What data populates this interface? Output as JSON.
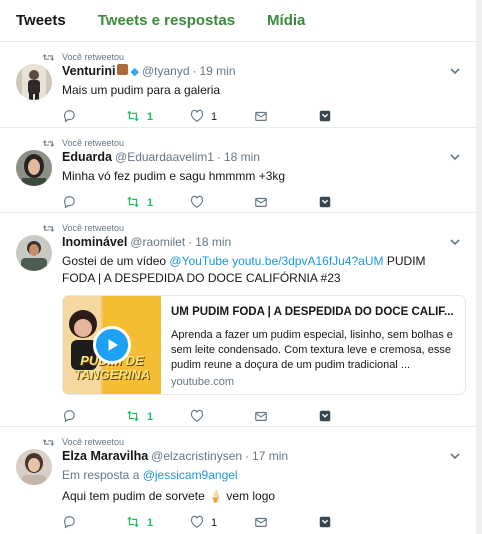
{
  "tabs": [
    {
      "label": "Tweets"
    },
    {
      "label": "Tweets e respostas"
    },
    {
      "label": "Mídia"
    }
  ],
  "context_label": "Você retweetou",
  "tweets": [
    {
      "name": "Venturini",
      "handle": "@tyanyd",
      "time": "19 min",
      "text": "Mais um pudim para a galeria",
      "retweets": "1",
      "likes": "1"
    },
    {
      "name": "Eduarda",
      "handle": "@Eduardaavelim1",
      "time": "18 min",
      "text": "Minha vó fez pudim e sagu hmmmm +3kg",
      "retweets": "1",
      "likes": ""
    },
    {
      "name": "Inominável",
      "handle": "@raomilet",
      "time": "18 min",
      "text_pre": "Gostei de um vídeo ",
      "text_link1": "@YouTube",
      "text_link2": "youtu.be/3dpvA16fJu4?aUM",
      "text_post": "PUDIM FODA | A DESPEDIDA DO DOCE CALIFÓRNIA #23",
      "card_title": "UM PUDIM FODA | A DESPEDIDA DO DOCE CALIF...",
      "card_desc": "Aprenda a fazer um pudim especial, lisinho, sem bolhas e sem leite condensado. Com textura leve e cremosa, esse pudim reune a doçura de um pudim tradicional ...",
      "card_domain": "youtube.com",
      "card_thumb_text": "PUDIM DE TANGERINA",
      "retweets": "1",
      "likes": ""
    },
    {
      "name": "Elza Maravilha",
      "handle": "@elzacristinysen",
      "time": "17 min",
      "reply_prefix": "Em resposta a ",
      "reply_to": "@jessicam9angel",
      "text": "Aqui tem pudim de sorvete 🍦 vem logo",
      "retweets": "1",
      "likes": "1"
    }
  ],
  "colors": {
    "accent_green": "#3a8a3a",
    "retweet_green": "#17bf63",
    "link_blue": "#1b95e0",
    "muted": "#657786"
  },
  "icons": [
    "retweet-icon",
    "reply-icon",
    "heart-icon",
    "mail-icon",
    "share-icon",
    "chevron-down-icon",
    "play-icon"
  ]
}
